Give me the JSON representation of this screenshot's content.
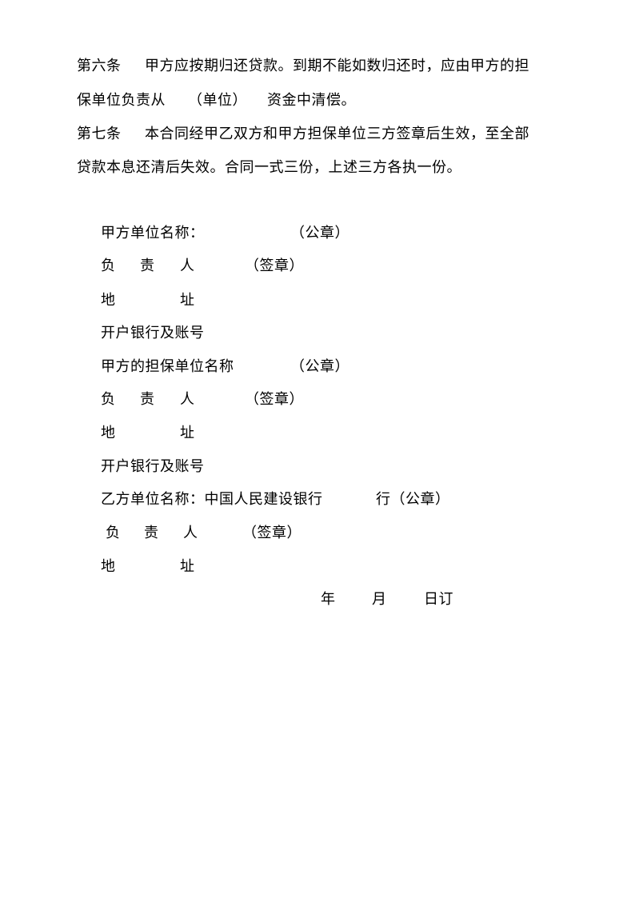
{
  "article6": {
    "heading": "第六条",
    "line1": "甲方应按期归还贷款。到期不能如数归还时，应由甲方的担",
    "line2_a": "保单位负责从",
    "line2_b": "（单位）",
    "line2_c": "资金中清偿。"
  },
  "article7": {
    "heading": "第七条",
    "line1": "本合同经甲乙双方和甲方担保单位三方签章后生效，至全部",
    "line2": "贷款本息还清后失效。合同一式三份，上述三方各执一份。"
  },
  "party_a": {
    "name_label": "甲方单位名称：",
    "name_seal": "（公章）",
    "rep_label": [
      "负",
      "责",
      "人"
    ],
    "rep_seal": "（签章）",
    "address_label": [
      "地",
      "址"
    ],
    "bank_label": "开户银行及账号"
  },
  "guarantor": {
    "name_label": "甲方的担保单位名称",
    "name_seal": "（公章）",
    "rep_label": [
      "负",
      "责",
      "人"
    ],
    "rep_seal": "（签章）",
    "address_label": [
      "地",
      "址"
    ],
    "bank_label": "开户银行及账号"
  },
  "party_b": {
    "name_label": "乙方单位名称：中国人民建设银行",
    "name_seal": "行（公章）",
    "rep_label": [
      "负",
      "责",
      "人"
    ],
    "rep_seal": "（签章）",
    "address_label": [
      "地",
      "址"
    ]
  },
  "date": {
    "year": "年",
    "month": "月",
    "day": "日订"
  }
}
